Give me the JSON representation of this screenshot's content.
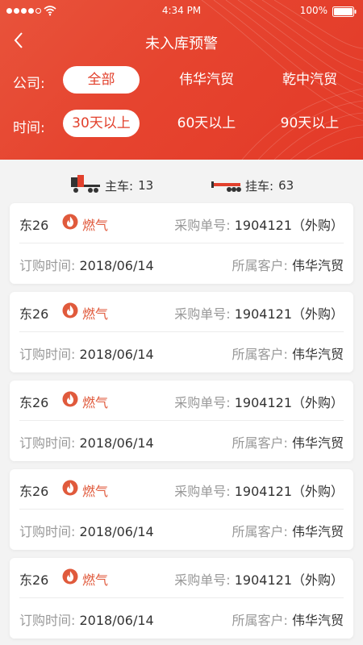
{
  "status_bar": {
    "time": "4:34 PM",
    "battery": "100%"
  },
  "header": {
    "title": "未入库预警"
  },
  "filters": {
    "company": {
      "label": "公司:",
      "options": [
        "全部",
        "伟华汽贸",
        "乾中汽贸"
      ],
      "selected": "全部"
    },
    "time": {
      "label": "时间:",
      "options": [
        "30天以上",
        "60天以上",
        "90天以上"
      ],
      "selected": "30天以上"
    }
  },
  "stats": {
    "main_label": "主车:",
    "main_count": "13",
    "trailer_label": "挂车:",
    "trailer_count": "63"
  },
  "cards": [
    {
      "route": "东26",
      "fuel": "燃气",
      "order_label": "采购单号:",
      "order_no": "1904121（外购）",
      "date_label": "订购时间:",
      "date": "2018/06/14",
      "customer_label": "所属客户:",
      "customer": "伟华汽贸"
    },
    {
      "route": "东26",
      "fuel": "燃气",
      "order_label": "采购单号:",
      "order_no": "1904121（外购）",
      "date_label": "订购时间:",
      "date": "2018/06/14",
      "customer_label": "所属客户:",
      "customer": "伟华汽贸"
    },
    {
      "route": "东26",
      "fuel": "燃气",
      "order_label": "采购单号:",
      "order_no": "1904121（外购）",
      "date_label": "订购时间:",
      "date": "2018/06/14",
      "customer_label": "所属客户:",
      "customer": "伟华汽贸"
    },
    {
      "route": "东26",
      "fuel": "燃气",
      "order_label": "采购单号:",
      "order_no": "1904121（外购）",
      "date_label": "订购时间:",
      "date": "2018/06/14",
      "customer_label": "所属客户:",
      "customer": "伟华汽贸"
    },
    {
      "route": "东26",
      "fuel": "燃气",
      "order_label": "采购单号:",
      "order_no": "1904121（外购）",
      "date_label": "订购时间:",
      "date": "2018/06/14",
      "customer_label": "所属客户:",
      "customer": "伟华汽贸"
    }
  ],
  "colors": {
    "header_red": "#e6442f",
    "accent_orange": "#e05a3c",
    "selected_text": "#e2402c"
  }
}
